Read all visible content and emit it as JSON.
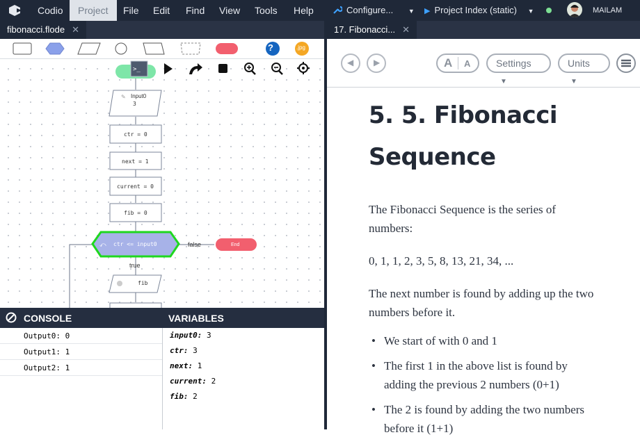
{
  "menubar": {
    "items": [
      "Codio",
      "Project",
      "File",
      "Edit",
      "Find",
      "View",
      "Tools",
      "Help"
    ],
    "configure_label": "Configure...",
    "project_index_label": "Project Index (static)",
    "user": "MAILAM"
  },
  "tabs": {
    "left": "fibonacci.flode",
    "right": "17. Fibonacci..."
  },
  "toolbar": {
    "jpg_label": ".jpg",
    "help_label": "?"
  },
  "flowchart": {
    "input_label": "Input0",
    "input_value": "3",
    "assign_ctr": "ctr = 0",
    "assign_next": "next = 1",
    "assign_current": "current = 0",
    "assign_fib": "fib = 0",
    "condition": "ctr <= input0",
    "false_label": "false",
    "end_label": "End",
    "true_label": "true",
    "fib_label": "fib"
  },
  "console": {
    "title": "CONSOLE",
    "outputs": [
      "Output0: 0",
      "Output1: 1",
      "Output2: 1"
    ]
  },
  "variables": {
    "title": "VARIABLES",
    "items": [
      {
        "name": "input0:",
        "value": "3"
      },
      {
        "name": "ctr:",
        "value": "3"
      },
      {
        "name": "next:",
        "value": "1"
      },
      {
        "name": "current:",
        "value": "2"
      },
      {
        "name": "fib:",
        "value": "2"
      }
    ]
  },
  "guide": {
    "font_a_large": "A",
    "font_a_small": "A",
    "settings_label": "Settings",
    "units_label": "Units",
    "title_line1": "5. 5. Fibonacci",
    "title_line2": "Sequence",
    "p1": "The Fibonacci Sequence is the series of numbers:",
    "p2": "0, 1, 1, 2, 3, 5, 8, 13, 21, 34, ...",
    "p3": "The next number is found by adding up the two numbers before it.",
    "bullets": [
      "We start of with 0 and 1",
      "The first 1 in the above list is found by adding the previous 2 numbers (0+1)",
      "The 2 is found by adding the two numbers before it (1+1)"
    ]
  },
  "colors": {
    "menubar_bg": "#1f2838",
    "highlight_green": "#1ed81e",
    "condition_fill": "#a7b2e8",
    "end_fill": "#f25f6e",
    "start_fill": "#7ee6a8"
  }
}
